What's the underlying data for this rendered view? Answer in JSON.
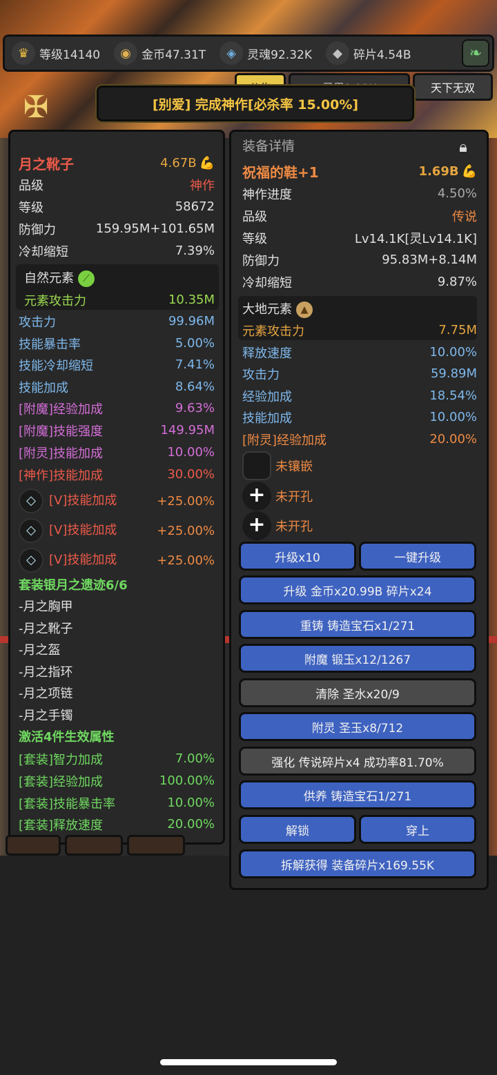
{
  "topbar": {
    "level": "等级14140",
    "gold": "金币47.31T",
    "soul": "灵魂92.32K",
    "fragment": "碎片4.54B"
  },
  "subtabs": {
    "announce": "公告",
    "spirit": "灵果1.23K",
    "peerless": "天下无双"
  },
  "notice": "[别爱] 完成神作[必杀率 15.00%]",
  "left": {
    "name": "月之靴子",
    "power": "4.67B",
    "rows": [
      {
        "l": "品级",
        "r": "神作"
      },
      {
        "l": "等级",
        "r": "58672"
      },
      {
        "l": "防御力",
        "r": "159.95M+101.65M"
      },
      {
        "l": "冷却缩短",
        "r": "7.39%"
      }
    ],
    "element_title": "自然元素",
    "element_attack": {
      "l": "元素攻击力",
      "r": "10.35M"
    },
    "stats": [
      {
        "l": "攻击力",
        "r": "99.96M"
      },
      {
        "l": "技能暴击率",
        "r": "5.00%"
      },
      {
        "l": "技能冷却缩短",
        "r": "7.41%"
      },
      {
        "l": "技能加成",
        "r": "8.64%"
      },
      {
        "l": "[附魔]经验加成",
        "r": "9.63%"
      },
      {
        "l": "[附魔]技能强度",
        "r": "149.95M"
      },
      {
        "l": "[附灵]技能加成",
        "r": "10.00%"
      },
      {
        "l": "[神作]技能加成",
        "r": "30.00%"
      }
    ],
    "gems": [
      {
        "l": "[V]技能加成",
        "r": "+25.00%"
      },
      {
        "l": "[V]技能加成",
        "r": "+25.00%"
      },
      {
        "l": "[V]技能加成",
        "r": "+25.00%"
      }
    ],
    "set_title": "套装银月之遗迹6/6",
    "set_items": [
      "-月之胸甲",
      "-月之靴子",
      "-月之盔",
      "-月之指环",
      "-月之项链",
      "-月之手镯"
    ],
    "activate_title": "激活4件生效属性",
    "set_bonus": [
      {
        "l": "[套装]智力加成",
        "r": "7.00%"
      },
      {
        "l": "[套装]经验加成",
        "r": "100.00%"
      },
      {
        "l": "[套装]技能暴击率",
        "r": "10.00%"
      },
      {
        "l": "[套装]释放速度",
        "r": "20.00%"
      }
    ]
  },
  "right": {
    "header": "装备详情",
    "name": "祝福的鞋+1",
    "power": "1.69B",
    "rows": [
      {
        "l": "神作进度",
        "r": "4.50%"
      },
      {
        "l": "品级",
        "r": "传说"
      },
      {
        "l": "等级",
        "r": "Lv14.1K[灵Lv14.1K]"
      },
      {
        "l": "防御力",
        "r": "95.83M+8.14M"
      },
      {
        "l": "冷却缩短",
        "r": "9.87%"
      }
    ],
    "element_title": "大地元素",
    "element_attack": {
      "l": "元素攻击力",
      "r": "7.75M"
    },
    "stats": [
      {
        "l": "释放速度",
        "r": "10.00%"
      },
      {
        "l": "攻击力",
        "r": "59.89M"
      },
      {
        "l": "经验加成",
        "r": "18.54%"
      },
      {
        "l": "技能加成",
        "r": "10.00%"
      },
      {
        "l": "[附灵]经验加成",
        "r": "20.00%"
      }
    ],
    "sockets": [
      "未镶嵌",
      "未开孔",
      "未开孔"
    ],
    "buttons": {
      "upgrade10": "升级x10",
      "oneclick": "一键升级",
      "upgrade": "升级 金币x20.99B 碎片x24",
      "recast": "重铸 铸造宝石x1/271",
      "enchant": "附魔 锻玉x12/1267",
      "clear": "清除 圣水x20/9",
      "spirit": "附灵 圣玉x8/712",
      "strengthen": "强化 传说碎片x4 成功率81.70%",
      "nurture": "供养 铸造宝石1/271",
      "unlock": "解锁",
      "equip": "穿上",
      "dismantle": "拆解获得 装备碎片x169.55K"
    }
  },
  "colors": {
    "button_blue": "#3e62c0",
    "button_gray": "#4a4a4a",
    "legendary": "#ee8a44",
    "masterpiece": "#ec5a4a",
    "set_green": "#6fd860"
  }
}
